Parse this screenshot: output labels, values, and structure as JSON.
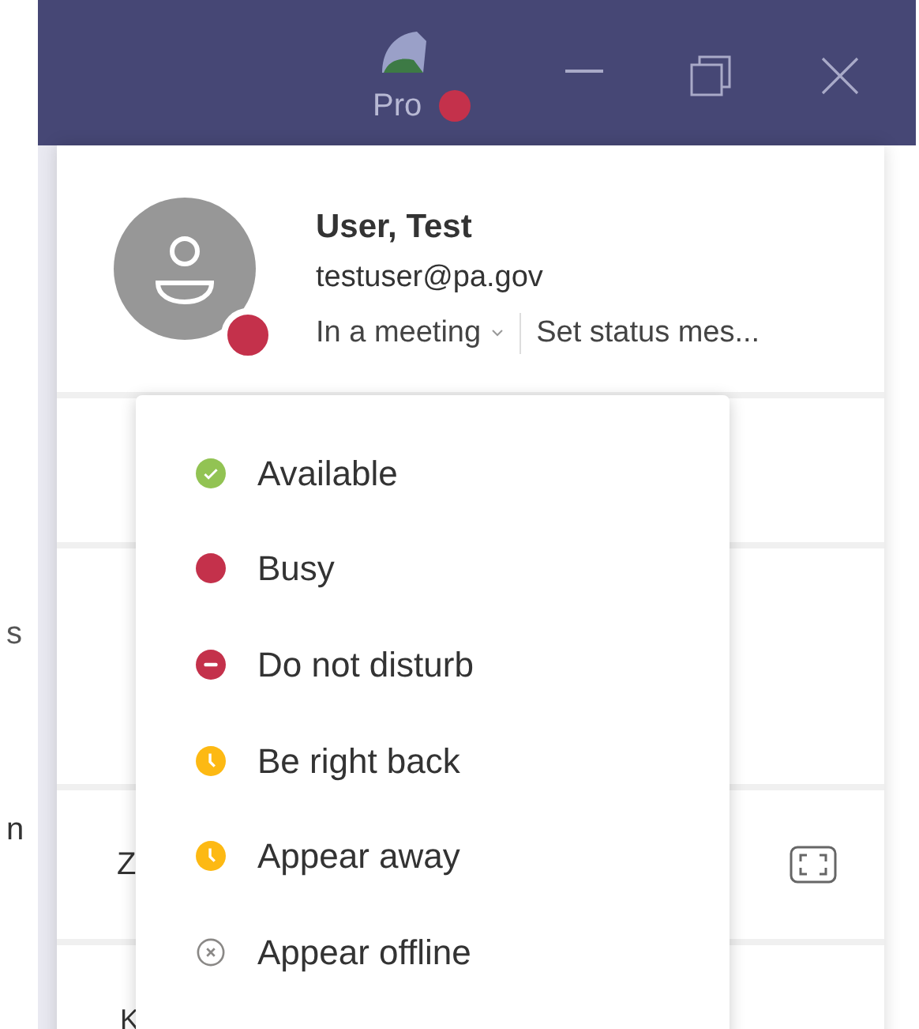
{
  "title_bar": {
    "app_label": "Pro",
    "busy": true
  },
  "background": {
    "left_fragments": [
      "s",
      "n"
    ],
    "menu_fragments": [
      "Z",
      "K"
    ]
  },
  "profile": {
    "name": "User, Test",
    "email": "testuser@pa.gov",
    "status": "In a meeting",
    "busy": true,
    "status_message": "Set status mes..."
  },
  "status_menu": [
    {
      "label": "Available",
      "kind": "available",
      "color": "#92c353"
    },
    {
      "label": "Busy",
      "kind": "busy",
      "color": "#c4314b"
    },
    {
      "label": "Do not disturb",
      "kind": "dnd",
      "color": "#c4314b"
    },
    {
      "label": "Be right back",
      "kind": "away",
      "color": "#fdb913"
    },
    {
      "label": "Appear away",
      "kind": "away",
      "color": "#fdb913"
    },
    {
      "label": "Appear offline",
      "kind": "offline",
      "color": "#8a8886"
    }
  ]
}
